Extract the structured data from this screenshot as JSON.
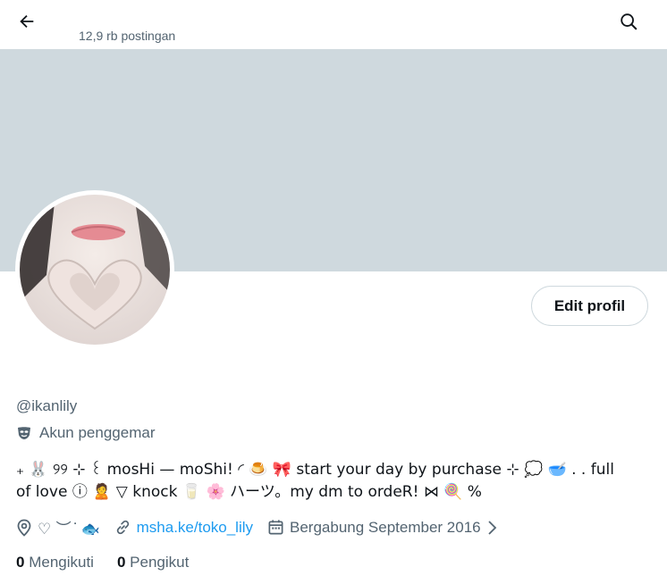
{
  "header": {
    "post_count": "12,9 rb postingan"
  },
  "profile": {
    "edit_label": "Edit profil",
    "handle": "@ikanlily",
    "badge_label": "Akun penggemar",
    "bio_line1": "₊ 🐰 ୨୨ ⊹ ꒰ mosHi — moShi! ◜ 🍮 🎀    start your day by purchase ⊹ 💭 🥣 . . full",
    "bio_line2": "of love ⓘ 🙎 ▽ knock 🥛 🌸 ハーツ。my dm to ordeR! ⋈ 🍭     %",
    "location": "♡ ︶ ͘ 🐟",
    "website": "msha.ke/toko_lily",
    "joined": "Bergabung September 2016",
    "following_count": "0",
    "following_label": "Mengikuti",
    "followers_count": "0",
    "followers_label": "Pengikut"
  },
  "colors": {
    "banner": "#cfd9de",
    "link": "#1d9bf0",
    "muted": "#536471"
  },
  "icons": [
    "back-arrow-icon",
    "search-icon",
    "fan-mask-icon",
    "location-pin-icon",
    "link-icon",
    "calendar-icon",
    "chevron-right-icon"
  ]
}
